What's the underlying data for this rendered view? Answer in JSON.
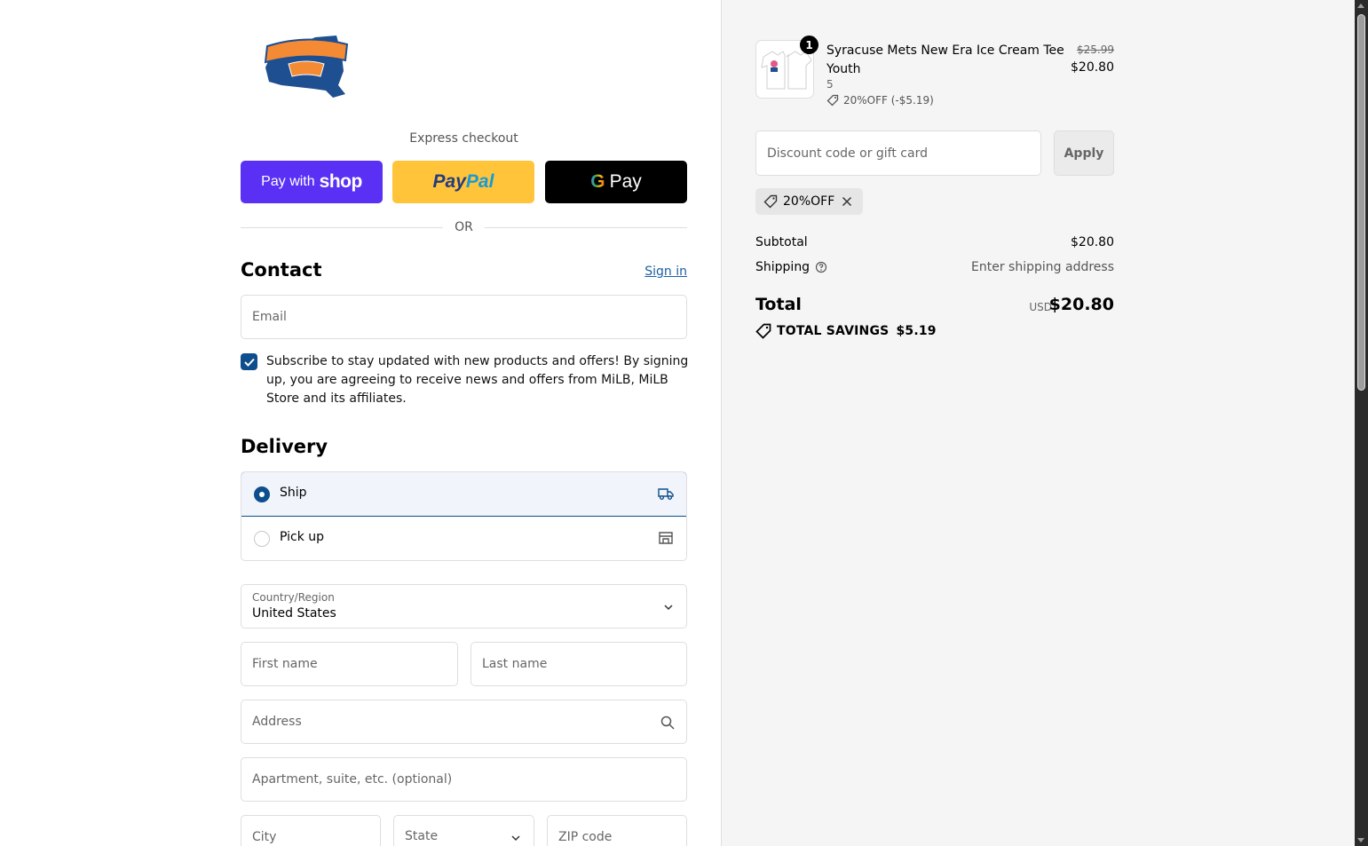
{
  "express": {
    "label": "Express checkout",
    "shop_prefix": "Pay with",
    "shop_word": "shop",
    "paypal_a": "Pay",
    "paypal_b": "Pal",
    "gpay_g": "G",
    "gpay_word": "Pay",
    "or": "OR"
  },
  "contact": {
    "title": "Contact",
    "signin": "Sign in",
    "email_placeholder": "Email",
    "subscribe_checked": true,
    "subscribe_text": "Subscribe to stay updated with new products and offers! By signing up, you are agreeing to receive news and offers from MiLB, MiLB Store and its affiliates."
  },
  "delivery": {
    "title": "Delivery",
    "options": [
      {
        "label": "Ship",
        "selected": true,
        "icon": "truck-icon"
      },
      {
        "label": "Pick up",
        "selected": false,
        "icon": "store-icon"
      }
    ]
  },
  "address": {
    "country_label": "Country/Region",
    "country_value": "United States",
    "first_name_placeholder": "First name",
    "last_name_placeholder": "Last name",
    "address_placeholder": "Address",
    "apartment_placeholder": "Apartment, suite, etc. (optional)",
    "city_placeholder": "City",
    "state_placeholder": "State",
    "zip_placeholder": "ZIP code"
  },
  "order": {
    "item": {
      "name": "Syracuse Mets New Era Ice Cream Tee Youth",
      "variant": "5",
      "quantity": "1",
      "discount": "20%OFF (-$5.19)",
      "price_old": "$25.99",
      "price_new": "$20.80"
    },
    "discount_placeholder": "Discount code or gift card",
    "apply_label": "Apply",
    "applied_code": "20%OFF",
    "subtotal_label": "Subtotal",
    "subtotal_value": "$20.80",
    "shipping_label": "Shipping",
    "shipping_value": "Enter shipping address",
    "total_label": "Total",
    "currency": "USD",
    "total_value": "$20.80",
    "savings_label": "TOTAL SAVINGS",
    "savings_value": "$5.19"
  },
  "colors": {
    "accent": "#0e4e8c",
    "shop_purple": "#5a31f4",
    "paypal_yellow": "#ffc439",
    "link": "#1b5fa0"
  }
}
